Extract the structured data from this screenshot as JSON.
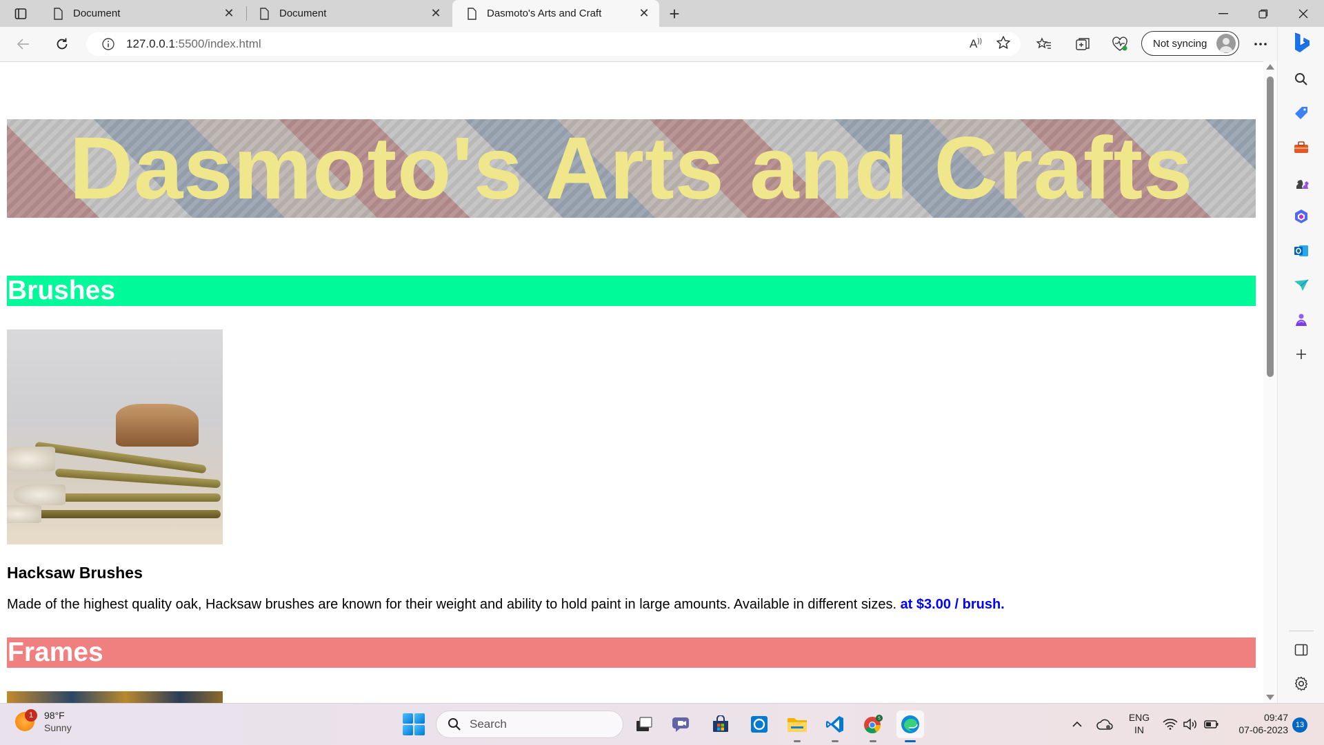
{
  "browser": {
    "tabs": [
      {
        "title": "Document",
        "active": false
      },
      {
        "title": "Document",
        "active": false
      },
      {
        "title": "Dasmoto's Arts and Craft",
        "active": true
      }
    ],
    "address": {
      "host": "127.0.0.1",
      "path": ":5500/index.html"
    },
    "profile_label": "Not syncing",
    "icons": {
      "read_aloud": "A’̇"
    }
  },
  "page": {
    "banner_title": "Dasmoto's Arts and Crafts",
    "sections": [
      {
        "heading": "Brushes",
        "color": "#00fa9a"
      },
      {
        "heading": "Frames",
        "color": "#f08080"
      }
    ],
    "product": {
      "title": "Hacksaw Brushes",
      "description": "Made of the highest quality oak, Hacksaw brushes are known for their weight and ability to hold paint in large amounts. Available in different sizes. ",
      "price": "at $3.00 / brush."
    },
    "title_color": "#f0e68c",
    "price_color": "#0000ff"
  },
  "taskbar": {
    "weather_temp": "98°F",
    "weather_cond": "Sunny",
    "weather_badge": "1",
    "search_label": "Search",
    "lang_top": "ENG",
    "lang_bottom": "IN",
    "time": "09:47",
    "date": "07-06-2023",
    "notifications": "13"
  }
}
